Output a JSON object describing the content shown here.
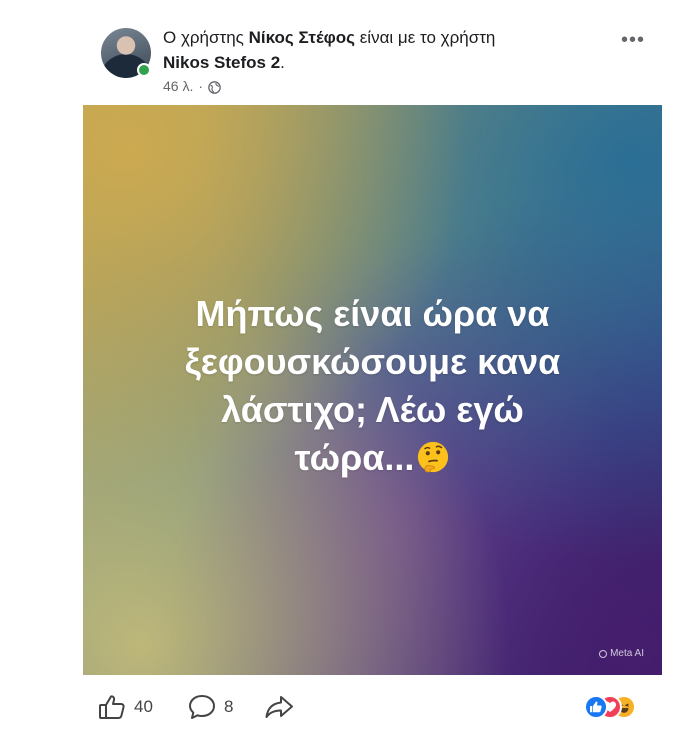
{
  "post": {
    "line1_prefix": "Ο χρήστης ",
    "author": "Νίκος Στέφος",
    "line1_suffix": " είναι με το χρήστη",
    "tagged": "Nikos Stefos 2",
    "tagged_suffix": ".",
    "time": "46 λ.",
    "separator": "·",
    "privacy_icon": "globe-icon",
    "more_label": "•••"
  },
  "image": {
    "text_lines": [
      "Μήπως είναι ώρα να",
      "ξεφουσκώσουμε κανα",
      "λάστιχο; Λέω εγώ",
      "τώρα..."
    ],
    "emoji": "thinking-face",
    "watermark": "Meta AI",
    "colors": {
      "top_left": "#cdaa50",
      "top_right": "#286e96",
      "bottom_right": "#461e6e"
    }
  },
  "actions": {
    "like_count": "40",
    "comment_count": "8",
    "reactions": [
      "like",
      "love",
      "haha"
    ]
  }
}
